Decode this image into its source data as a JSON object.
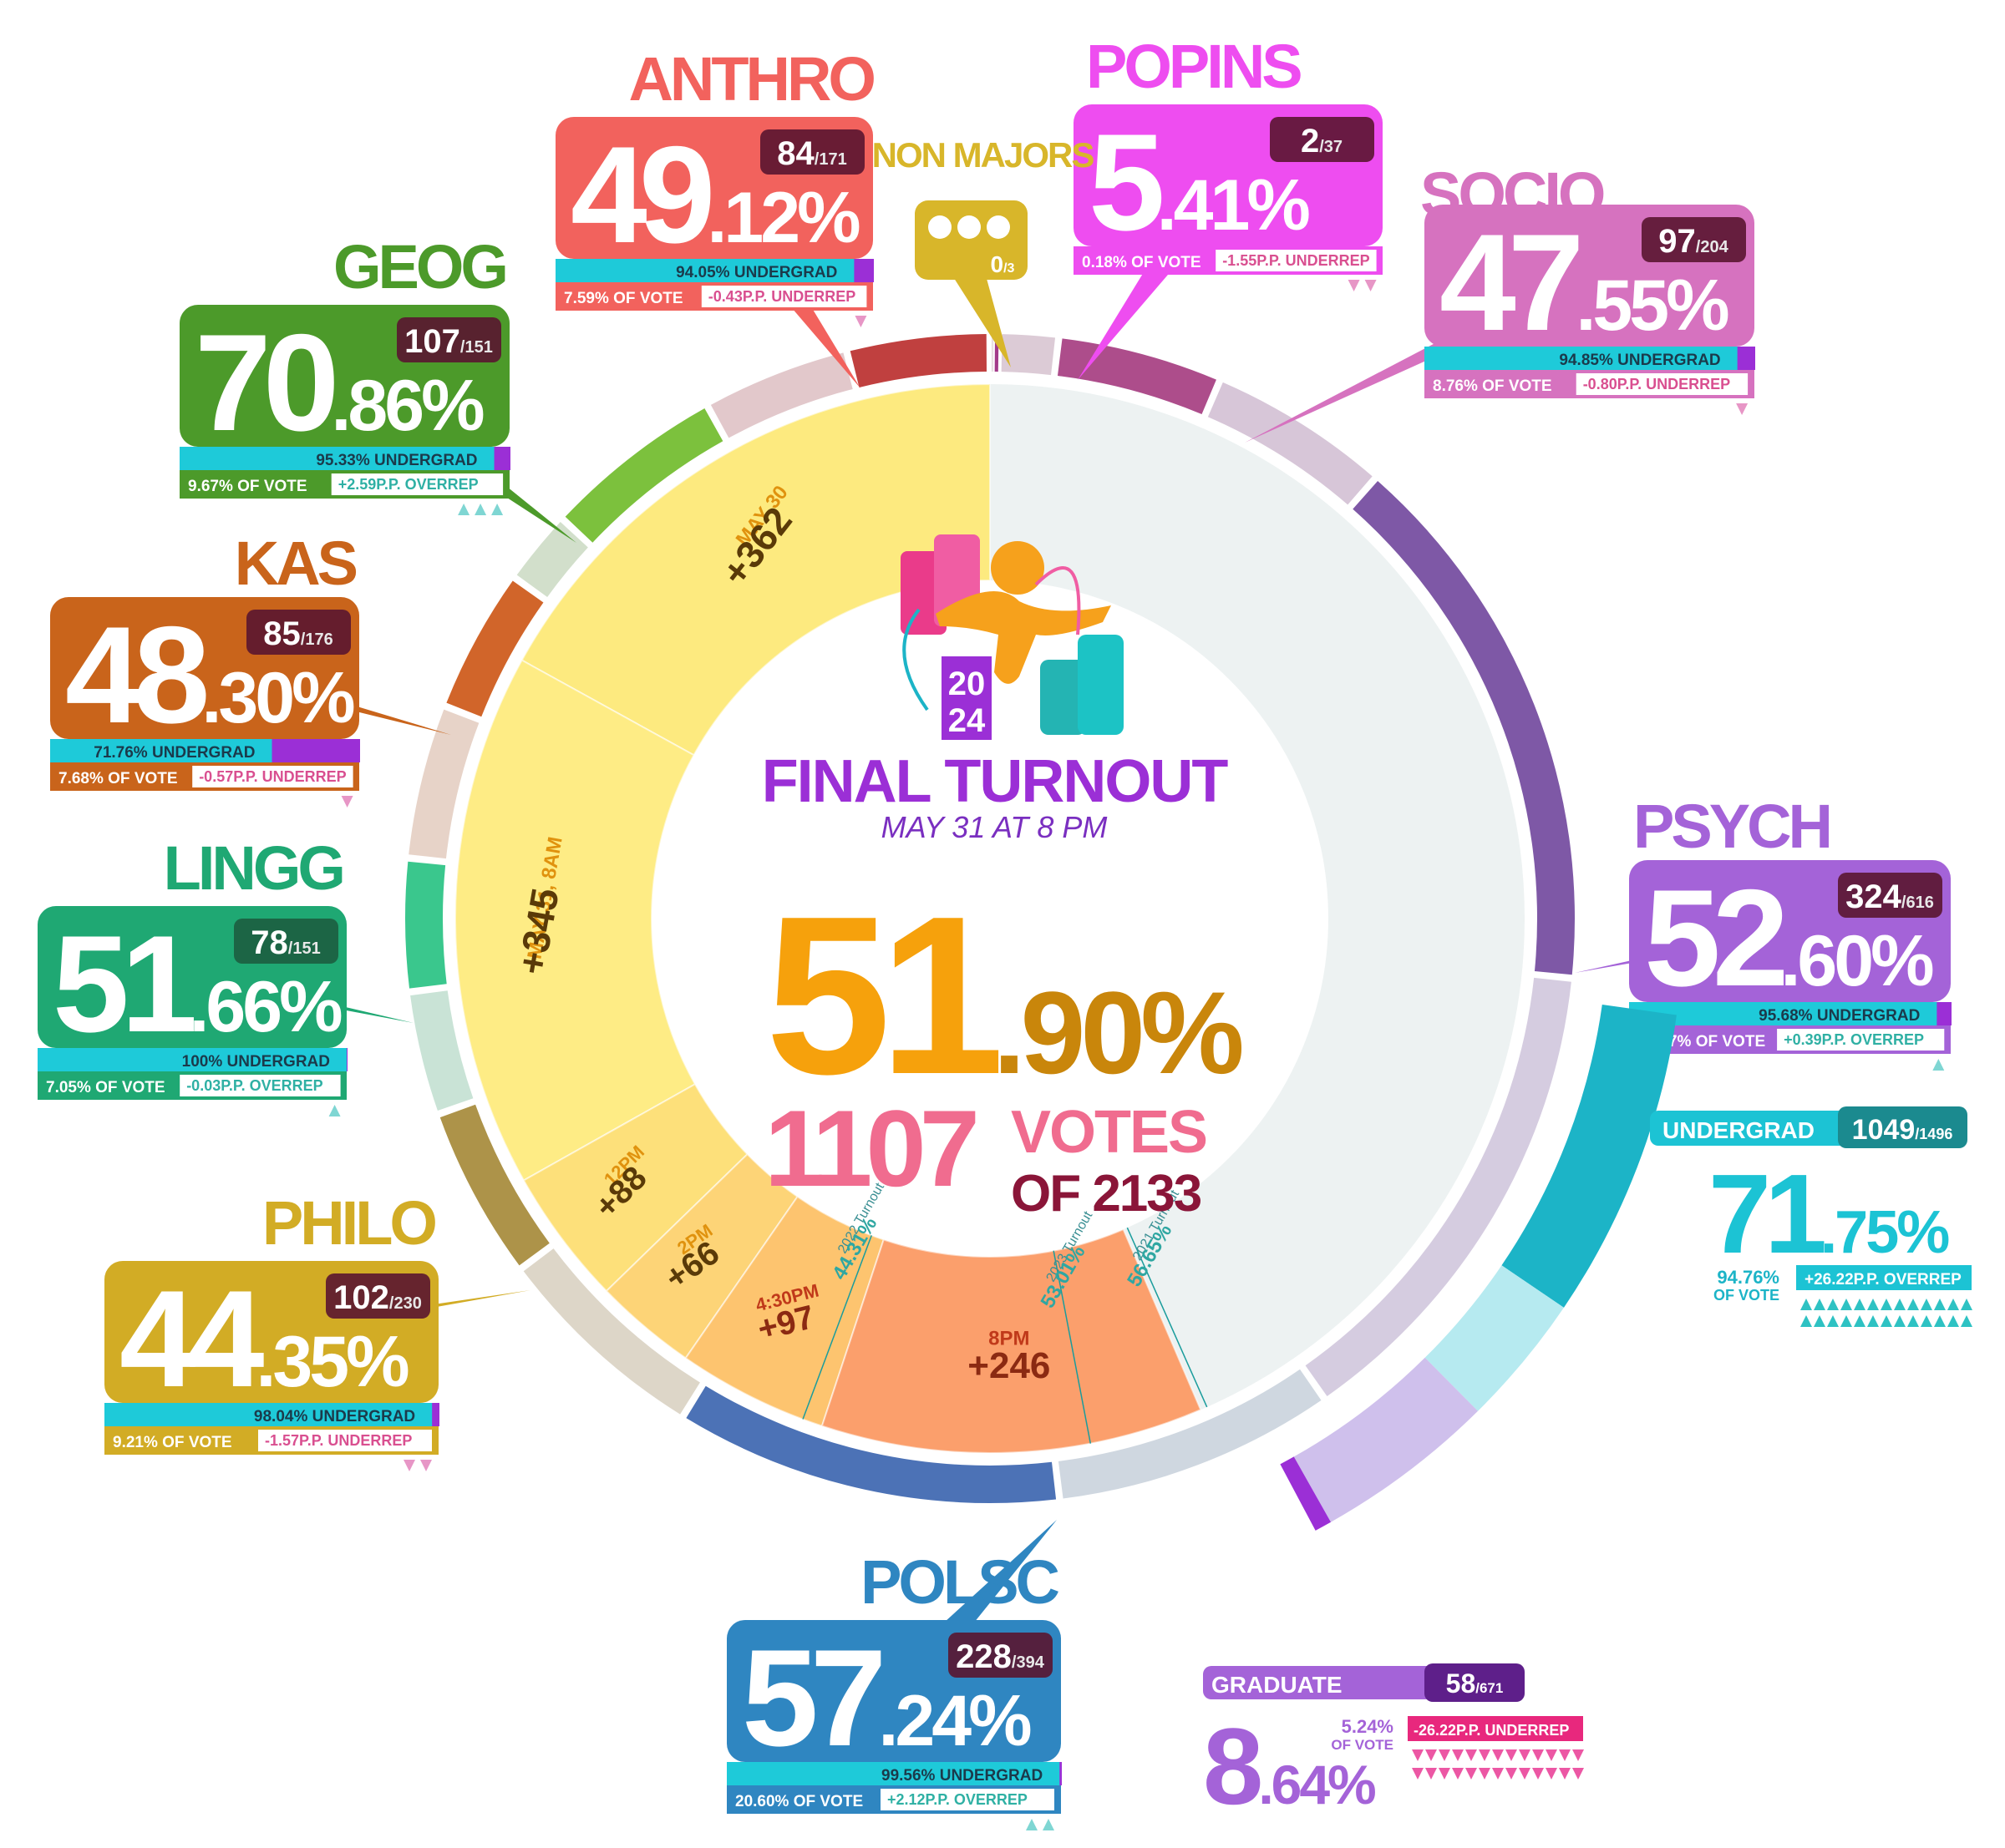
{
  "title": "FINAL TURNOUT",
  "subtitle": "MAY 31 AT 8 PM",
  "logo_text": [
    "20",
    "24"
  ],
  "center": {
    "pct_int": "51",
    "pct_dec": ".90%",
    "votes": "1107",
    "votes_label": "VOTES",
    "of_label": "OF 2133"
  },
  "colors": {
    "gold": "#f6a10c",
    "goldDark": "#c9860b",
    "pink": "#f06c8f",
    "maroon": "#8a1538",
    "purple": "#9b2fd6",
    "teal": "#1cb4c7",
    "cyan": "#27c3d6",
    "paleBg": "#edf2f2"
  },
  "chart_data": [
    {
      "type": "pie",
      "name": "turnout by time",
      "total_voters": 2133,
      "votes_cast": 1107,
      "turnout_pct": 51.9,
      "slices": [
        {
          "label": "MAY 30",
          "value": 362,
          "text": "+362",
          "color": "#fdea7f"
        },
        {
          "label": "MAY 31, 8AM",
          "value": 345,
          "text": "+345",
          "color": "#feec85"
        },
        {
          "label": "12PM",
          "value": 88,
          "text": "+88",
          "color": "#fde07a"
        },
        {
          "label": "2PM",
          "value": 66,
          "text": "+66",
          "color": "#fdd477"
        },
        {
          "label": "4:30PM",
          "value": 97,
          "text": "+97",
          "color": "#fdc46f"
        },
        {
          "label": "8PM",
          "value": 246,
          "text": "+246",
          "color": "#fb9f6c"
        },
        {
          "label": "remaining",
          "value": 1026,
          "text": "",
          "color": "#edf2f2"
        }
      ],
      "reference_lines": [
        {
          "label": "2022 Turnout",
          "value": "44.31%"
        },
        {
          "label": "2023 Turnout",
          "value": "53.01%"
        },
        {
          "label": "2021 Turnout",
          "value": "56.65%"
        }
      ]
    },
    {
      "type": "pie",
      "name": "turnout by department",
      "departments": [
        {
          "key": "anthro",
          "name": "ANTHRO",
          "pct_int": "49",
          "pct_dec": ".12%",
          "voted": 84,
          "total": 171,
          "undergrad": "94.05% UNDERGRAD",
          "undergrad_pct": 94.05,
          "of_vote": "7.59% OF VOTE",
          "rep": "-0.43P.P. UNDERREP",
          "color": "#f2625d",
          "dark": "#c0403f",
          "light": "#e2c8cb",
          "arrows": 1
        },
        {
          "key": "nonmajors",
          "name": "NON MAJORS",
          "voted": 0,
          "total": 3,
          "color": "#d8b62a",
          "dark": "#c9a521",
          "light": "#e8dfe3"
        },
        {
          "key": "popins",
          "name": "POPINS",
          "pct_int": "5",
          "pct_dec": ".41%",
          "voted": 2,
          "total": 37,
          "of_vote": "0.18% OF VOTE",
          "rep": "-1.55P.P. UNDERREP",
          "color": "#ee4df0",
          "dark": "#a33b8a",
          "light": "#dccbd6",
          "arrows": 2
        },
        {
          "key": "socio",
          "name": "SOCIO",
          "pct_int": "47",
          "pct_dec": ".55%",
          "voted": 97,
          "total": 204,
          "undergrad": "94.85% UNDERGRAD",
          "undergrad_pct": 94.85,
          "of_vote": "8.76% OF VOTE",
          "rep": "-0.80P.P. UNDERREP",
          "color": "#d672bf",
          "dark": "#ad4d8b",
          "light": "#d7c6d8",
          "arrows": 1
        },
        {
          "key": "psych",
          "name": "PSYCH",
          "pct_int": "52",
          "pct_dec": ".60%",
          "voted": 324,
          "total": 616,
          "undergrad": "95.68% UNDERGRAD",
          "undergrad_pct": 95.68,
          "of_vote": "29.27% OF VOTE",
          "rep": "+0.39P.P. OVERREP",
          "color": "#a463d8",
          "dark": "#7e58a6",
          "light": "#d5cce0",
          "arrows": 1
        },
        {
          "key": "polsc",
          "name": "POLSC",
          "pct_int": "57",
          "pct_dec": ".24%",
          "voted": 228,
          "total": 394,
          "undergrad": "99.56% UNDERGRAD",
          "undergrad_pct": 99.56,
          "of_vote": "20.60% OF VOTE",
          "rep": "+2.12P.P. OVERREP",
          "color": "#2f86c1",
          "dark": "#4c72b6",
          "light": "#cfd7e0",
          "arrows": 2
        },
        {
          "key": "philo",
          "name": "PHILO",
          "pct_int": "44",
          "pct_dec": ".35%",
          "voted": 102,
          "total": 230,
          "undergrad": "98.04% UNDERGRAD",
          "undergrad_pct": 98.04,
          "of_vote": "9.21% OF VOTE",
          "rep": "-1.57P.P. UNDERREP",
          "color": "#d2ac25",
          "dark": "#ad9349",
          "light": "#ddd6c8",
          "arrows": 2
        },
        {
          "key": "lingg",
          "name": "LINGG",
          "pct_int": "51",
          "pct_dec": ".66%",
          "voted": 78,
          "total": 151,
          "undergrad": "100% UNDERGRAD",
          "undergrad_pct": 100,
          "of_vote": "7.05% OF VOTE",
          "rep": "-0.03P.P. OVERREP",
          "color": "#1fa873",
          "dark": "#3ac78d",
          "light": "#c9e3d6",
          "arrows": 1
        },
        {
          "key": "kas",
          "name": "KAS",
          "pct_int": "48",
          "pct_dec": ".30%",
          "voted": 85,
          "total": 176,
          "undergrad": "71.76% UNDERGRAD",
          "undergrad_pct": 71.76,
          "of_vote": "7.68% OF VOTE",
          "rep": "-0.57P.P. UNDERREP",
          "color": "#c9641b",
          "dark": "#d1652a",
          "light": "#e7d3c8",
          "arrows": 1
        },
        {
          "key": "geog",
          "name": "GEOG",
          "pct_int": "70",
          "pct_dec": ".86%",
          "voted": 107,
          "total": 151,
          "undergrad": "95.33% UNDERGRAD",
          "undergrad_pct": 95.33,
          "of_vote": "9.67% OF VOTE",
          "rep": "+2.59P.P. OVERREP",
          "color": "#4c9a2a",
          "dark": "#7cc13d",
          "light": "#d2dfcb",
          "arrows": 3
        }
      ]
    },
    {
      "type": "bar",
      "name": "undergrad vs graduate",
      "groups": [
        {
          "key": "undergrad",
          "name": "UNDERGRAD",
          "voted": 1049,
          "total": 1496,
          "pct_int": "71",
          "pct_dec": ".75%",
          "of_vote_pct": "94.76%",
          "of_vote_label": "OF VOTE",
          "rep": "+26.22P.P. OVERREP",
          "color": "#1cb4c7",
          "light": "#b6eaf0",
          "arrows": 26
        },
        {
          "key": "graduate",
          "name": "GRADUATE",
          "voted": 58,
          "total": 671,
          "pct_int": "8",
          "pct_dec": ".64%",
          "of_vote_pct": "5.24%",
          "of_vote_label": "OF VOTE",
          "rep": "-26.22P.P. UNDERREP",
          "color": "#a463d8",
          "light": "#cfc0ec",
          "arrows": 26
        }
      ]
    }
  ]
}
